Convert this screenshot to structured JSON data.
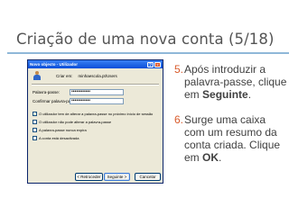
{
  "slide": {
    "title": "Criação de uma nova conta (5/18)"
  },
  "dialog": {
    "title": "Novo objecto - Utilizador",
    "help_glyph": "?",
    "close_glyph": "×",
    "create_in_label": "Criar em:",
    "create_in_value": "minhaescola.pt/Users",
    "password_label": "Palavra-passe:",
    "password_value": "••••••••••••",
    "confirm_label": "Confirmar palavra-passe:",
    "confirm_value": "••••••••••••",
    "options": [
      {
        "label": "O utilizador tem de alterar a palavra-passe no próximo início de sessão",
        "checked": true
      },
      {
        "label": "O utilizador não pode alterar a palavra-passe",
        "checked": false
      },
      {
        "label": "A palavra-passe nunca expira",
        "checked": false
      },
      {
        "label": "A conta está desactivada",
        "checked": false
      }
    ],
    "check_glyph": "✓",
    "back_button": "< Retroceder",
    "next_button": "Seguinte >",
    "cancel_button": "Cancelar"
  },
  "steps": [
    {
      "number": "5.",
      "text_before": "Após introduzir a palavra-passe, clique em ",
      "bold": "Seguinte",
      "text_after": "."
    },
    {
      "number": "6.",
      "text_before": "Surge uma caixa com um resumo da conta criada. Clique em ",
      "bold": "OK",
      "text_after": "."
    }
  ],
  "colors": {
    "title_text": "#555555",
    "rule": "#8fb8d8",
    "step_number": "#d95b2b",
    "body_text": "#404040",
    "xp_titlebar": "#0a4ed8"
  }
}
